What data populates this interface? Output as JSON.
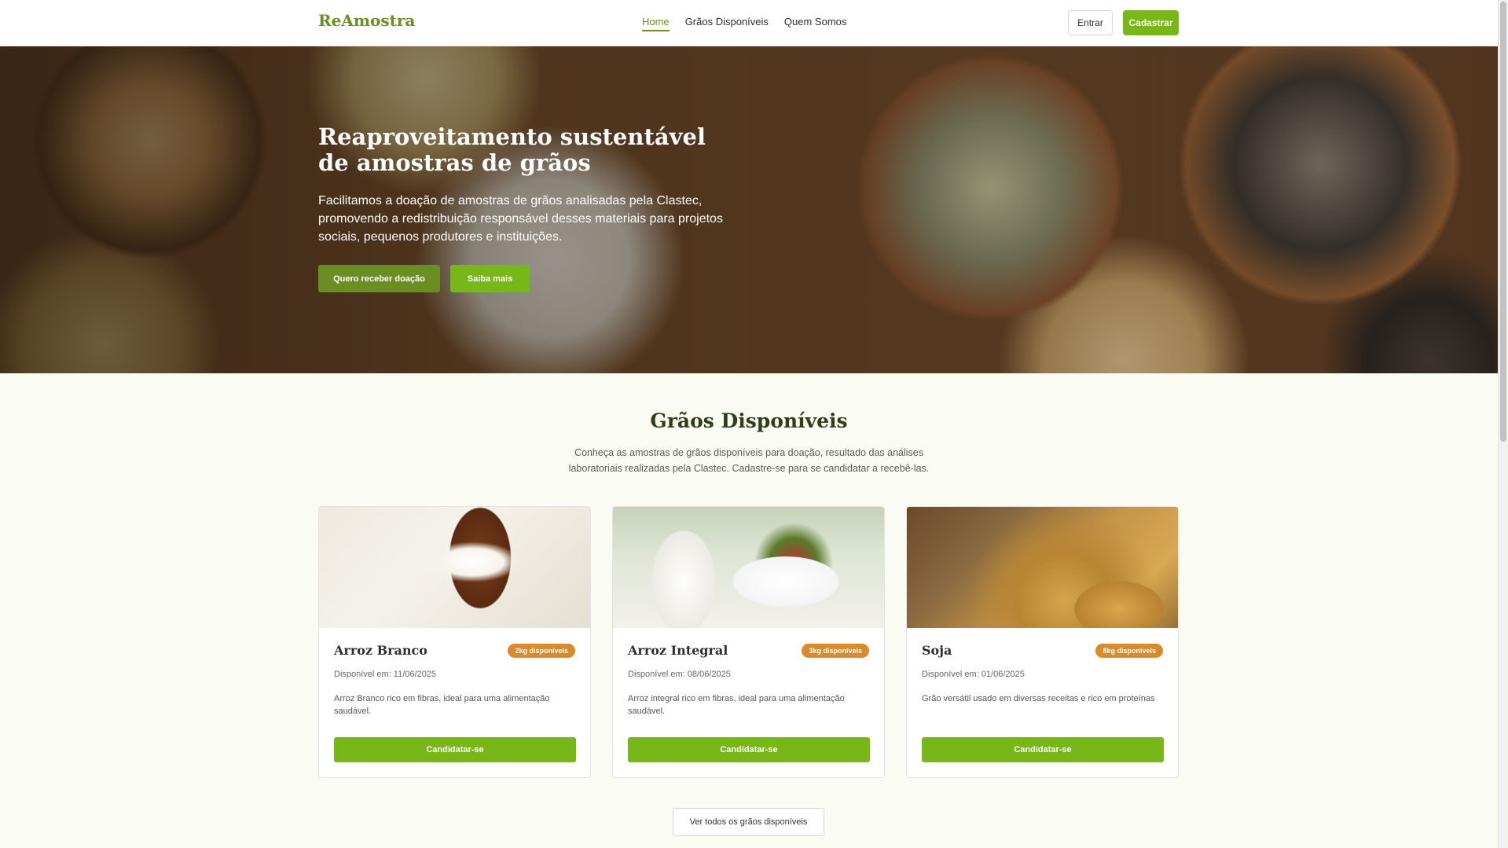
{
  "navbar": {
    "brand": "ReAmostra",
    "links": [
      {
        "label": "Home",
        "active": true
      },
      {
        "label": "Grãos Disponíveis",
        "active": false
      },
      {
        "label": "Quem Somos",
        "active": false
      }
    ],
    "login_label": "Entrar",
    "signup_label": "Cadastrar"
  },
  "hero": {
    "title": "Reaproveitamento sustentável de amostras de grãos",
    "text": "Facilitamos a doação de amostras de grãos analisadas pela Clastec, promovendo a redistribuição responsável desses materiais para projetos sociais, pequenos produtores e instituições.",
    "primary_button": "Quero receber doação",
    "secondary_button": "Saiba mais"
  },
  "section": {
    "title": "Grãos Disponíveis",
    "description": "Conheça as amostras de grãos disponíveis para doação, resultado das análises laboratoriais realizadas pela Clastec. Cadastre-se para se candidatar a recebê-las."
  },
  "cards": [
    {
      "name": "Arroz Branco",
      "badge": "2kg disponíveis",
      "date": "Disponível em: 11/06/2025",
      "description": "Arroz Branco rico em fibras, ideal para uma alimentação saudável.",
      "button": "Candidatar-se",
      "image": "white-rice-photo"
    },
    {
      "name": "Arroz Integral",
      "badge": "3kg disponíveis",
      "date": "Disponível em: 08/06/2025",
      "description": "Arroz integral rico em fibras, ideal para uma alimentação saudável.",
      "button": "Candidatar-se",
      "image": "milk-and-fruit-bowl-photo"
    },
    {
      "name": "Soja",
      "badge": "8kg disponíveis",
      "date": "Disponível em: 01/06/2025",
      "description": "Grão versátil usado em diversas receitas e rico em proteínas",
      "button": "Candidatar-se",
      "image": "soybeans-photo"
    }
  ],
  "view_all_label": "Ver todos os grãos disponíveis",
  "colors": {
    "brand": "#6b8e23",
    "primary": "#77b818",
    "badge": "#d98b2b",
    "heading": "#2e3f1a"
  }
}
